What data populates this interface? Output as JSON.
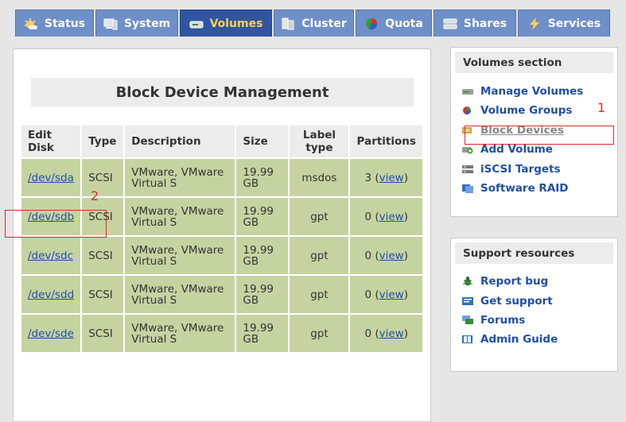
{
  "tabs": [
    {
      "label": "Status",
      "icon": "sun-icon"
    },
    {
      "label": "System",
      "icon": "computer-icon"
    },
    {
      "label": "Volumes",
      "icon": "disk-icon",
      "active": true
    },
    {
      "label": "Cluster",
      "icon": "cluster-icon"
    },
    {
      "label": "Quota",
      "icon": "pie-icon"
    },
    {
      "label": "Shares",
      "icon": "server-icon"
    },
    {
      "label": "Services",
      "icon": "lightning-icon"
    }
  ],
  "page_title": "Block Device Management",
  "table": {
    "headers": [
      "Edit Disk",
      "Type",
      "Description",
      "Size",
      "Label type",
      "Partitions"
    ],
    "rows": [
      {
        "disk": "/dev/sda",
        "type": "SCSI",
        "desc": "VMware, VMware Virtual S",
        "size": "19.99 GB",
        "label": "msdos",
        "count": "3",
        "view": "view"
      },
      {
        "disk": "/dev/sdb",
        "type": "SCSI",
        "desc": "VMware, VMware Virtual S",
        "size": "19.99 GB",
        "label": "gpt",
        "count": "0",
        "view": "view"
      },
      {
        "disk": "/dev/sdc",
        "type": "SCSI",
        "desc": "VMware, VMware Virtual S",
        "size": "19.99 GB",
        "label": "gpt",
        "count": "0",
        "view": "view"
      },
      {
        "disk": "/dev/sdd",
        "type": "SCSI",
        "desc": "VMware, VMware Virtual S",
        "size": "19.99 GB",
        "label": "gpt",
        "count": "0",
        "view": "view"
      },
      {
        "disk": "/dev/sde",
        "type": "SCSI",
        "desc": "VMware, VMware Virtual S",
        "size": "19.99 GB",
        "label": "gpt",
        "count": "0",
        "view": "view"
      }
    ]
  },
  "volumes_section": {
    "title": "Volumes section",
    "items": [
      {
        "label": "Manage Volumes",
        "icon": "drive-icon"
      },
      {
        "label": "Volume Groups",
        "icon": "volume-groups-icon"
      },
      {
        "label": "Block Devices",
        "icon": "block-devices-icon",
        "active": true
      },
      {
        "label": "Add Volume",
        "icon": "add-volume-icon"
      },
      {
        "label": "iSCSI Targets",
        "icon": "iscsi-icon"
      },
      {
        "label": "Software RAID",
        "icon": "raid-icon"
      }
    ]
  },
  "support_resources": {
    "title": "Support resources",
    "items": [
      {
        "label": "Report bug",
        "icon": "bug-icon"
      },
      {
        "label": "Get support",
        "icon": "support-icon"
      },
      {
        "label": "Forums",
        "icon": "forums-icon"
      },
      {
        "label": "Admin Guide",
        "icon": "book-icon"
      }
    ]
  },
  "annotations": {
    "one": "1",
    "two": "2"
  },
  "colors": {
    "tab": "#6f8fc9",
    "tab_active": "#2f55a3",
    "tab_active_text": "#ffd24d",
    "row": "#c5d3a1",
    "link": "#1f4ea8",
    "annotation": "#d62b2b"
  }
}
